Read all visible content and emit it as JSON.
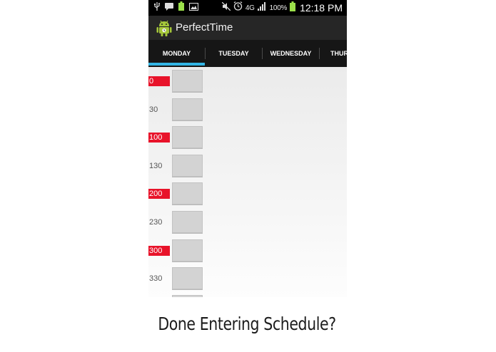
{
  "status_bar": {
    "network": "4G",
    "battery_percent": "100%",
    "time": "12:18 PM",
    "left_icons": [
      "usb-icon",
      "message-icon",
      "battery-small-icon",
      "gallery-icon"
    ],
    "right_icons": [
      "mute-icon",
      "alarm-icon",
      "signal-icon",
      "battery-icon"
    ]
  },
  "action_bar": {
    "title": "PerfectTime",
    "logo_icon": "android-robot-icon"
  },
  "tabs": [
    {
      "label": "MONDAY",
      "selected": true
    },
    {
      "label": "TUESDAY",
      "selected": false
    },
    {
      "label": "WEDNESDAY",
      "selected": false
    },
    {
      "label": "THUR",
      "selected": false
    }
  ],
  "schedule": [
    {
      "time": "0",
      "hour": true
    },
    {
      "time": "30",
      "hour": false
    },
    {
      "time": "100",
      "hour": true
    },
    {
      "time": "130",
      "hour": false
    },
    {
      "time": "200",
      "hour": true
    },
    {
      "time": "230",
      "hour": false
    },
    {
      "time": "300",
      "hour": true
    },
    {
      "time": "330",
      "hour": false
    }
  ],
  "caption": "Done Entering Schedule?",
  "colors": {
    "accent": "#33b5e5",
    "hour_highlight": "#e8132a",
    "slot": "#d3d3d3"
  }
}
